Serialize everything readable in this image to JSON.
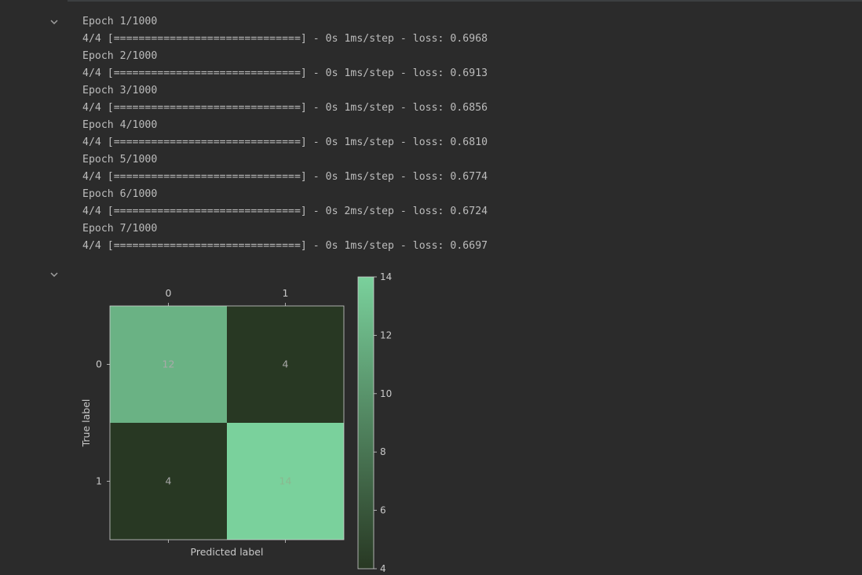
{
  "training_log": {
    "lines": [
      "Epoch 1/1000",
      "4/4 [==============================] - 0s 1ms/step - loss: 0.6968",
      "Epoch 2/1000",
      "4/4 [==============================] - 0s 1ms/step - loss: 0.6913",
      "Epoch 3/1000",
      "4/4 [==============================] - 0s 1ms/step - loss: 0.6856",
      "Epoch 4/1000",
      "4/4 [==============================] - 0s 1ms/step - loss: 0.6810",
      "Epoch 5/1000",
      "4/4 [==============================] - 0s 1ms/step - loss: 0.6774",
      "Epoch 6/1000",
      "4/4 [==============================] - 0s 2ms/step - loss: 0.6724",
      "Epoch 7/1000",
      "4/4 [==============================] - 0s 1ms/step - loss: 0.6697"
    ]
  },
  "icons": {
    "collapse": "chevron-down-icon"
  },
  "colors": {
    "background": "#2b2b2b",
    "text": "#bcbcbc",
    "cmap_low": "#283823",
    "cmap_high": "#7ad19c",
    "cell_text_light": "#a9a9a9",
    "cell_text_on_bright": "#8ab88f"
  },
  "chart_data": {
    "type": "heatmap",
    "xlabel": "Predicted label",
    "ylabel": "True label",
    "x_tick_labels": [
      "0",
      "1"
    ],
    "y_tick_labels": [
      "0",
      "1"
    ],
    "matrix": [
      [
        12,
        4
      ],
      [
        4,
        14
      ]
    ],
    "colorbar": {
      "min": 4,
      "max": 14,
      "ticks": [
        "4",
        "6",
        "8",
        "10",
        "12",
        "14"
      ]
    }
  }
}
